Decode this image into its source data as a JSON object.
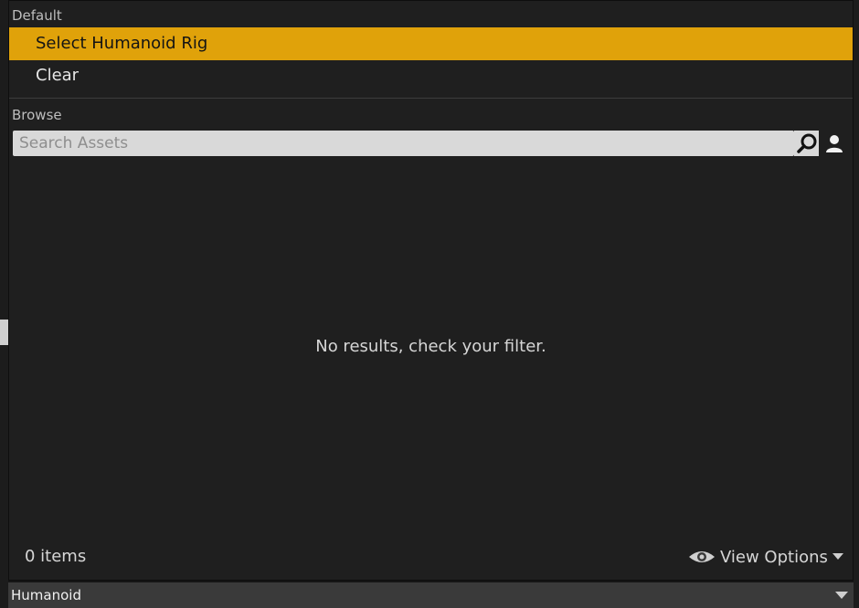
{
  "default_section": {
    "label": "Default",
    "items": [
      {
        "label": "Select Humanoid Rig",
        "selected": true
      },
      {
        "label": "Clear",
        "selected": false
      }
    ]
  },
  "browse_section": {
    "label": "Browse",
    "search": {
      "placeholder": "Search Assets",
      "value": ""
    }
  },
  "results": {
    "empty_message": "No results, check your filter."
  },
  "footer": {
    "item_count": "0 items",
    "view_options_label": "View Options"
  },
  "asset_picker": {
    "value": "Humanoid"
  },
  "colors": {
    "accent": "#e0a20a",
    "panel": "#1f1f1f",
    "search_bg": "#d9d9d9"
  },
  "icons": {
    "search": "search-icon",
    "user": "user-icon",
    "eye": "eye-icon",
    "dropdown": "chevron-down-icon"
  }
}
